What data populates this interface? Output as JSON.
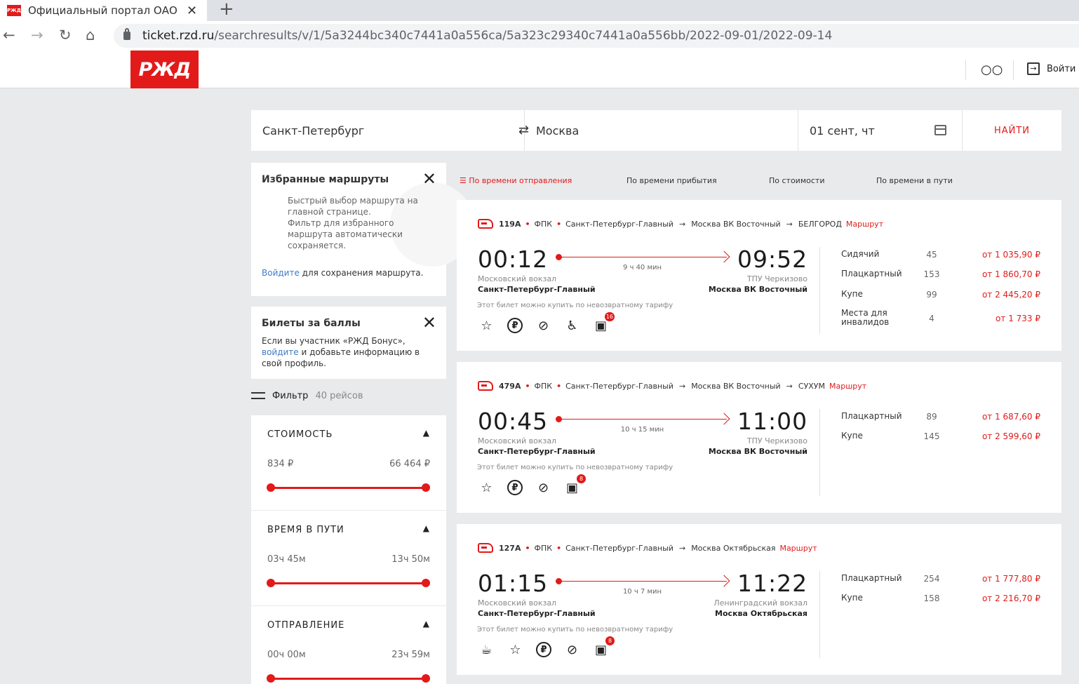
{
  "browser": {
    "tab_title": "Официальный портал ОАО «РЖД»",
    "tab_favicon": "РЖД",
    "url_domain": "ticket.rzd.ru",
    "url_path": "/searchresults/v/1/5a3244bc340c7441a0a556ca/5a323c29340c7441a0a556bb/2022-09-01/2022-09-14"
  },
  "header": {
    "logo": "РЖД",
    "login": "Войти"
  },
  "search": {
    "from": "Санкт-Петербург",
    "to": "Москва",
    "date": "01 сент, чт",
    "find": "НАЙТИ"
  },
  "favorites": {
    "title": "Избранные маршруты",
    "text1": "Быстрый выбор маршрута на главной странице.",
    "text2": "Фильтр для избранного маршрута автоматически сохраняется.",
    "login_link": "Войдите",
    "login_rest": "для сохранения маршрута."
  },
  "bonus": {
    "title": "Билеты за баллы",
    "text1": "Если вы участник «РЖД Бонус»,",
    "link": "войдите",
    "text2": "и добавьте информацию в свой профиль."
  },
  "filter": {
    "label": "Фильтр",
    "count": "40 рейсов"
  },
  "filters": [
    {
      "title": "СТОИМОСТЬ",
      "min": "834 ₽",
      "max": "66 464 ₽"
    },
    {
      "title": "ВРЕМЯ В ПУТИ",
      "min": "03ч 45м",
      "max": "13ч 50м"
    },
    {
      "title": "ОТПРАВЛЕНИЕ",
      "min": "00ч 00м",
      "max": "23ч 59м"
    }
  ],
  "sort": [
    "По времени отправления",
    "По времени прибытия",
    "По стоимости",
    "По времени в пути"
  ],
  "trains": [
    {
      "num": "119А",
      "carrier": "ФПК",
      "from": "Санкт-Петербург-Главный",
      "to": "Москва ВК Восточный",
      "final": "БЕЛГОРОД",
      "route_link": "Маршрут",
      "dep_time": "00:12",
      "arr_time": "09:52",
      "duration": "9 ч 40 мин",
      "dep_station": "Московский вокзал",
      "dep_city": "Санкт-Петербург-Главный",
      "arr_station": "ТПУ Черкизово",
      "arr_city": "Москва ВК Восточный",
      "tariff": "Этот билет можно купить по невозвратному тарифу",
      "badge": "16",
      "classes": [
        {
          "name": "Сидячий",
          "seats": "45",
          "price": "от 1 035,90 ₽"
        },
        {
          "name": "Плацкартный",
          "seats": "153",
          "price": "от 1 860,70 ₽"
        },
        {
          "name": "Купе",
          "seats": "99",
          "price": "от 2 445,20 ₽"
        },
        {
          "name": "Места для инвалидов",
          "seats": "4",
          "price": "от 1 733 ₽"
        }
      ]
    },
    {
      "num": "479А",
      "carrier": "ФПК",
      "from": "Санкт-Петербург-Главный",
      "to": "Москва ВК Восточный",
      "final": "СУХУМ",
      "route_link": "Маршрут",
      "dep_time": "00:45",
      "arr_time": "11:00",
      "duration": "10 ч 15 мин",
      "dep_station": "Московский вокзал",
      "dep_city": "Санкт-Петербург-Главный",
      "arr_station": "ТПУ Черкизово",
      "arr_city": "Москва ВК Восточный",
      "tariff": "Этот билет можно купить по невозвратному тарифу",
      "badge": "8",
      "classes": [
        {
          "name": "Плацкартный",
          "seats": "89",
          "price": "от 1 687,60 ₽"
        },
        {
          "name": "Купе",
          "seats": "145",
          "price": "от 2 599,60 ₽"
        }
      ]
    },
    {
      "num": "127А",
      "carrier": "ФПК",
      "from": "Санкт-Петербург-Главный",
      "to": "Москва Октябрьская",
      "final": "",
      "route_link": "Маршрут",
      "dep_time": "01:15",
      "arr_time": "11:22",
      "duration": "10 ч 7 мин",
      "dep_station": "Московский вокзал",
      "dep_city": "Санкт-Петербург-Главный",
      "arr_station": "Ленинградский вокзал",
      "arr_city": "Москва Октябрьская",
      "tariff": "Этот билет можно купить по невозвратному тарифу",
      "badge": "8",
      "classes": [
        {
          "name": "Плацкартный",
          "seats": "254",
          "price": "от 1 777,80 ₽"
        },
        {
          "name": "Купе",
          "seats": "158",
          "price": "от 2 216,70 ₽"
        }
      ]
    }
  ],
  "colors": {
    "brand": "#e21a1a",
    "link": "#3e7bc8",
    "background": "#e9eaec"
  }
}
